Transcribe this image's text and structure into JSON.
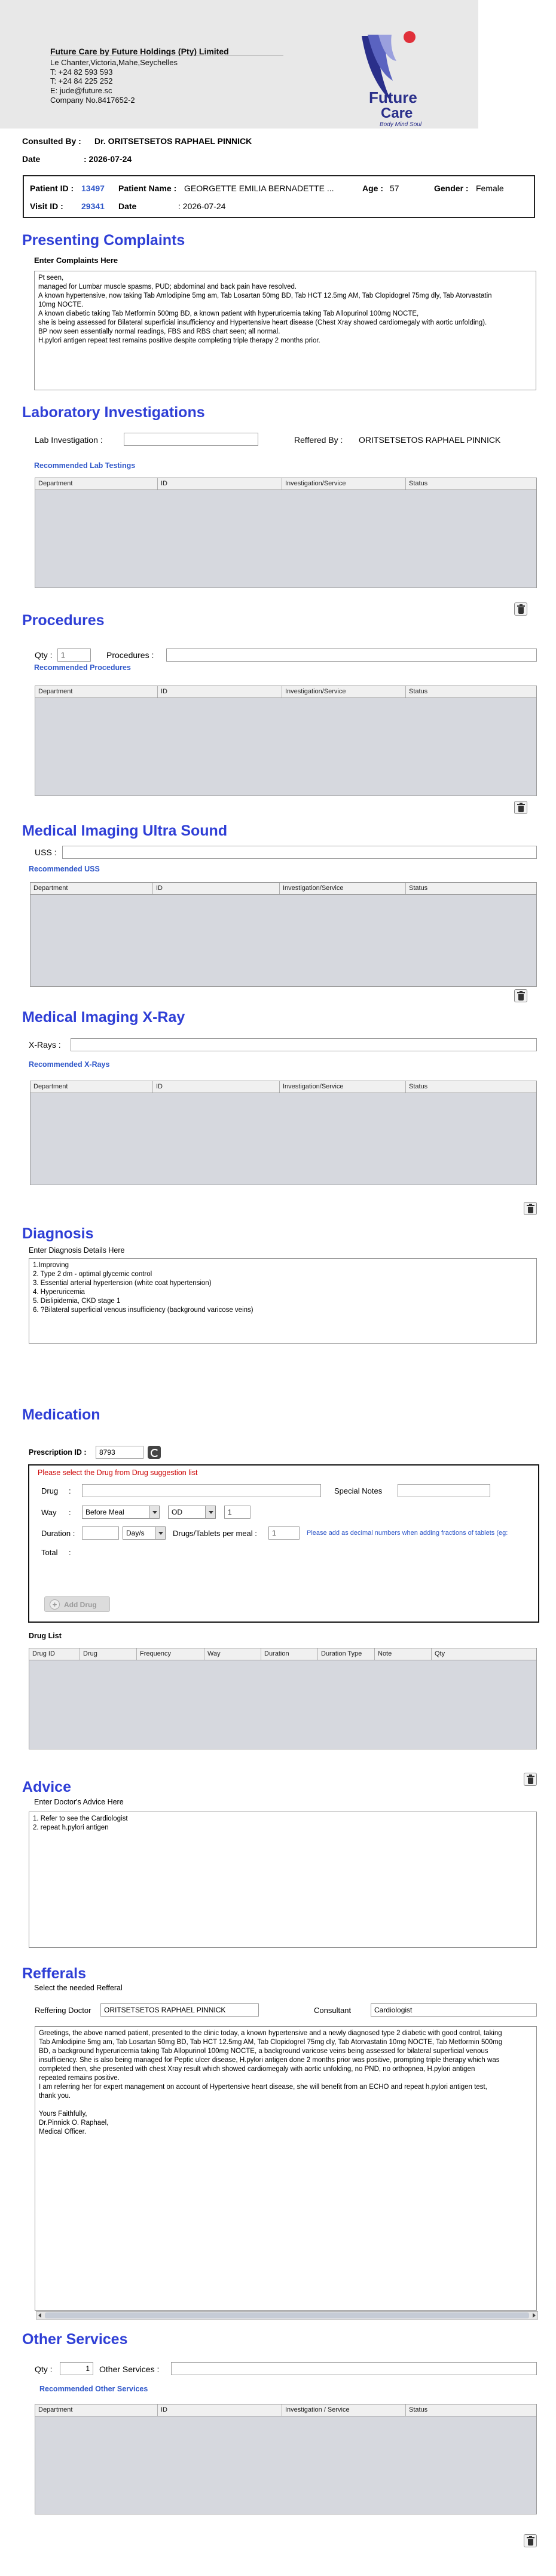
{
  "letterhead": {
    "company": "Future Care by Future Holdings (Pty) Limited",
    "address": "Le Chanter,Victoria,Mahe,Seychelles",
    "phone1": "T: +24  82 593 593",
    "phone2": "T: +24  84 225 252",
    "email": "E: jude@future.sc",
    "company_no": "Company No.8417652-2",
    "logo_word1": "Future",
    "logo_word2": "Care",
    "logo_tagline": "Body Mind Soul"
  },
  "consultation": {
    "consulted_by_label": "Consulted By :",
    "consulted_by_value": "Dr.  ORITSETSETOS RAPHAEL PINNICK",
    "date_label": "Date",
    "date_value": ":  2026-07-24"
  },
  "patient": {
    "id_label": "Patient ID :",
    "id_value": "13497",
    "name_label": "Patient Name :",
    "name_value": "GEORGETTE EMILIA BERNADETTE ...",
    "age_label": "Age :",
    "age_value": "57",
    "gender_label": "Gender :",
    "gender_value": "Female",
    "visit_label": "Visit ID :",
    "visit_value": "29341",
    "date_label": "Date",
    "date_value": ": 2026-07-24"
  },
  "complaints": {
    "title": "Presenting Complaints",
    "sub": "Enter Complaints Here",
    "lines": [
      "Pt seen,",
      "managed for Lumbar muscle spasms, PUD; abdominal and back pain have resolved.",
      "A known hypertensive, now taking Tab Amlodipine 5mg am, Tab Losartan 50mg BD, Tab HCT 12.5mg AM, Tab Clopidogrel 75mg dly, Tab Atorvastatin",
      "10mg NOCTE.",
      "A known diabetic taking Tab Metformin 500mg BD, a known patient with hyperuricemia taking Tab Allopurinol 100mg NOCTE,",
      "she is being assessed for Bilateral superficial insufficiency and Hypertensive heart disease (Chest Xray showed cardiomegaly with aortic unfolding).",
      "BP now seen essentially normal readings, FBS and RBS chart seen; all normal.",
      "H.pylori antigen repeat test remains positive despite completing triple therapy 2 months prior."
    ]
  },
  "grid_headers": {
    "department": "Department",
    "id": "ID",
    "investigation": "Investigation/Service",
    "status": "Status"
  },
  "lab": {
    "title": "Laboratory  Investigations",
    "input_label": "Lab Investigation :",
    "referred_label": "Reffered By :",
    "referred_value": "ORITSETSETOS RAPHAEL PINNICK",
    "recommended": "Recommended Lab Testings"
  },
  "procedures": {
    "title": "Procedures",
    "qty_label": "Qty :",
    "qty_value": "1",
    "proc_label": "Procedures :",
    "recommended": "Recommended Procedures"
  },
  "uss": {
    "title": "Medical Imaging Ultra Sound",
    "label": "USS :",
    "recommended": "Recommended USS"
  },
  "xray": {
    "title": "Medical Imaging X-Ray",
    "label": "X-Rays :",
    "recommended": "Recommended X-Rays"
  },
  "diagnosis": {
    "title": "Diagnosis",
    "sub": "Enter Diagnosis Details Here",
    "lines": [
      "1.Improving",
      "2. Type 2 dm - optimal glycemic control",
      "3. Essential arterial hypertension (white coat hypertension)",
      "4. Hyperuricemia",
      "5. Dislipidemia, CKD stage 1",
      "6. ?Bilateral superficial venous insufficiency (background varicose veins)"
    ]
  },
  "medication": {
    "title": "Medication",
    "prescription_label": "Prescription ID :",
    "prescription_value": "8793",
    "warning": "Please select the Drug from Drug suggestion list",
    "drug_label": "Drug",
    "special_label": "Special Notes",
    "way_label": "Way",
    "way_value": "Before Meal",
    "freq_value": "OD",
    "freq_qty": "1",
    "duration_label": "Duration :",
    "duration_unit": "Day/s",
    "per_meal_label": "Drugs/Tablets per meal :",
    "per_meal_value": "1",
    "decimal_hint": "Please add as decimal numbers when adding fractions of tablets (eg:",
    "total_label": "Total",
    "add_button": "Add Drug"
  },
  "drug_list": {
    "title": "Drug List",
    "headers": [
      "Drug ID",
      "Drug",
      "Frequency",
      "Way",
      "Duration",
      "Duration Type",
      "Note",
      "Qty"
    ]
  },
  "advice": {
    "title": "Advice",
    "sub": "Enter Doctor's Advice Here",
    "lines": [
      "1. Refer to see the Cardiologist",
      "2. repeat h.pylori antigen"
    ]
  },
  "referrals": {
    "title": "Refferals",
    "sub": "Select the needed Refferal",
    "doctor_label": "Reffering Doctor",
    "doctor_value": "ORITSETSETOS RAPHAEL PINNICK",
    "consultant_label": "Consultant",
    "consultant_value": "Cardiologist",
    "lines": [
      "Greetings, the above named patient, presented to the clinic today, a known hypertensive and a newly diagnosed type 2 diabetic with good control, taking",
      "Tab Amlodipine 5mg am, Tab Losartan 50mg BD, Tab HCT 12.5mg AM, Tab Clopidogrel 75mg dly, Tab Atorvastatin 10mg NOCTE, Tab Metformin 500mg",
      "BD, a background hyperuricemia taking Tab Allopurinol 100mg NOCTE, a background varicose veins being assessed for bilateral superficial venous",
      "insufficiency. She is also being managed for Peptic ulcer disease, H.pylori antigen done 2 months prior was positive, prompting triple therapy which was",
      "completed then, she presented with chest Xray result which showed cardiomegaly with aortic unfolding, no PND, no orthopnea, H.pylori antigen",
      "repeated remains positive.",
      "  I am referring her for expert management on account of Hypertensive heart disease, she will benefit from an ECHO and repeat h.pylori antigen test,",
      "thank you.",
      "",
      "Yours Faithfully,",
      "Dr.Pinnick O. Raphael,",
      "Medical Officer."
    ]
  },
  "other_services": {
    "title": "Other Services",
    "qty_label": "Qty :",
    "qty_value": "1",
    "label": "Other Services :",
    "recommended": "Recommended Other Services",
    "investigation_header": "Investigation / Service"
  },
  "colors": {
    "section_title": "#2f3fd6",
    "link_blue": "#2f57c9",
    "warning_red": "#cc0000",
    "grid_fill": "#d6d8de"
  },
  "icons": [
    "trash-icon",
    "refresh-icon",
    "plus-circle-icon"
  ]
}
